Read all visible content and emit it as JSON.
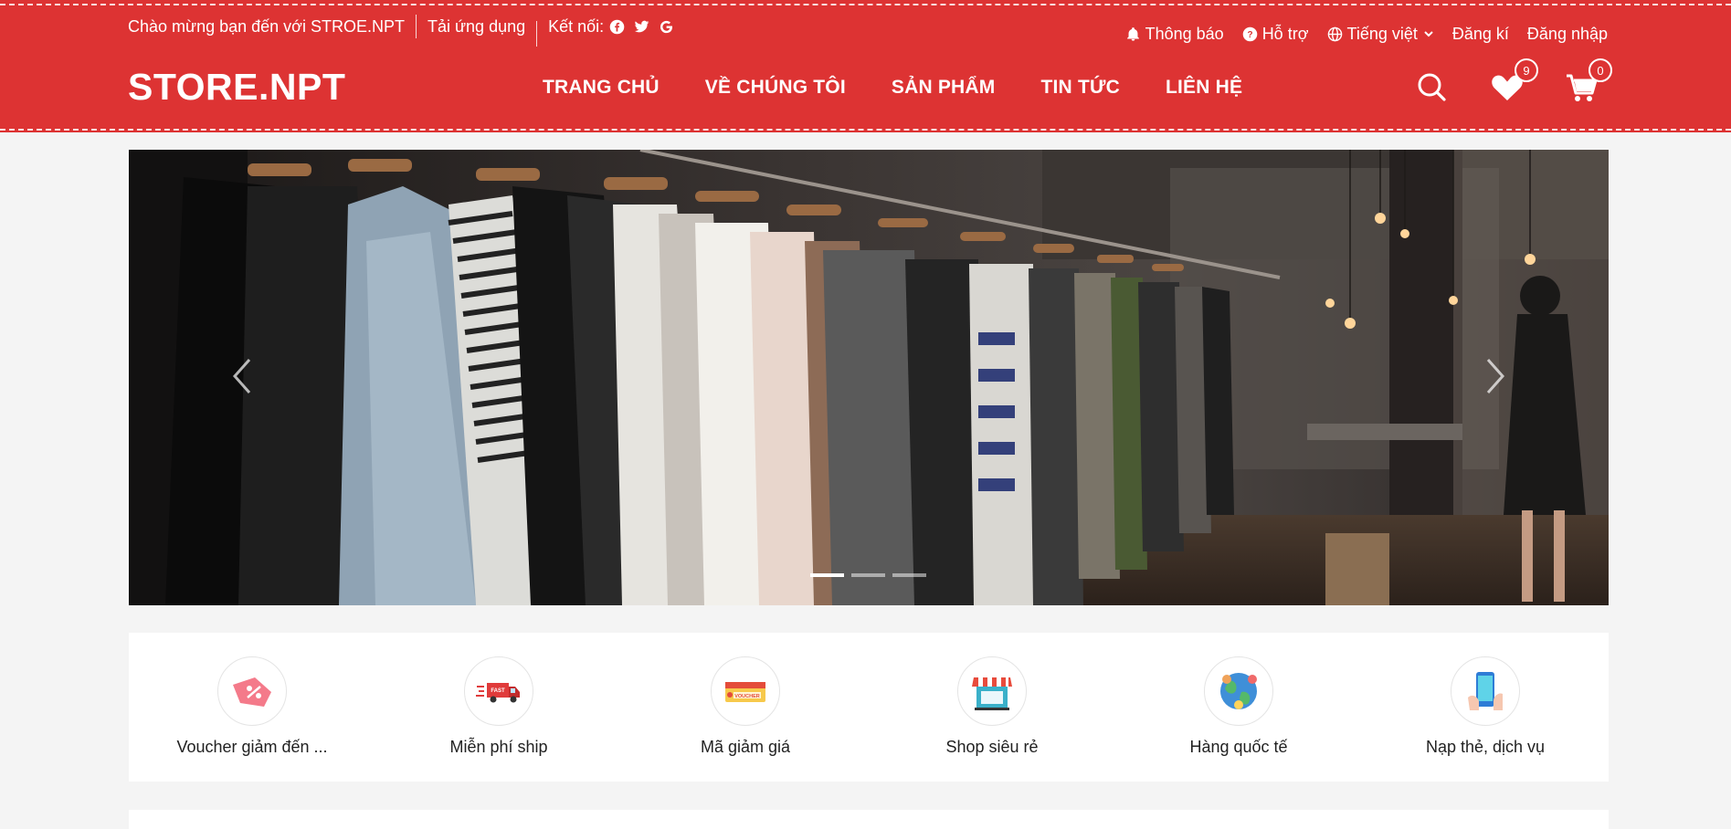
{
  "colors": {
    "brand": "#dd3333",
    "page_bg": "#f4f4f4"
  },
  "topbar": {
    "welcome": "Chào mừng bạn đến với STROE.NPT",
    "app": "Tải ứng dụng",
    "connect": "Kết nối:",
    "social_icons": [
      "facebook-icon",
      "twitter-icon",
      "google-icon"
    ],
    "notifications": "Thông báo",
    "support": "Hỗ trợ",
    "language": "Tiếng việt",
    "register": "Đăng kí",
    "login": "Đăng nhập"
  },
  "header": {
    "logo": "STORE.NPT",
    "nav": [
      "TRANG CHỦ",
      "VỀ CHÚNG TÔI",
      "SẢN PHẨM",
      "TIN TỨC",
      "LIÊN HỆ"
    ],
    "wishlist_count": "9",
    "cart_count": "0"
  },
  "banner": {
    "image": "clothing-rack-photo",
    "slides": 3,
    "active_slide": 1
  },
  "categories": [
    {
      "label": "Voucher giảm đến ...",
      "icon": "voucher-tag-icon"
    },
    {
      "label": "Miễn phí ship",
      "icon": "fast-truck-icon"
    },
    {
      "label": "Mã giảm giá",
      "icon": "voucher-ticket-icon"
    },
    {
      "label": "Shop siêu rẻ",
      "icon": "shop-icon"
    },
    {
      "label": "Hàng quốc tế",
      "icon": "globe-icon"
    },
    {
      "label": "Nạp thẻ, dịch vụ",
      "icon": "phone-topup-icon"
    }
  ]
}
